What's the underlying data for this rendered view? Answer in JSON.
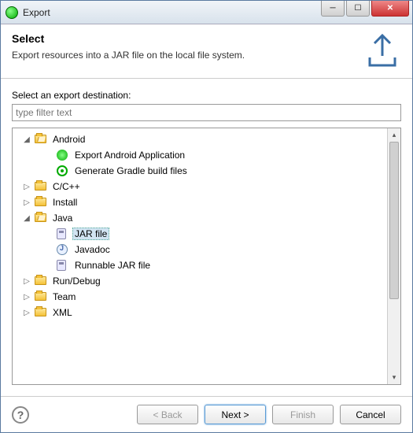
{
  "window": {
    "title": "Export"
  },
  "header": {
    "heading": "Select",
    "subtext": "Export resources into a JAR file on the local file system."
  },
  "body": {
    "label": "Select an export destination:",
    "filter_placeholder": "type filter text"
  },
  "tree": {
    "android": {
      "label": "Android",
      "children": {
        "export_app": "Export Android Application",
        "gradle": "Generate Gradle build files"
      }
    },
    "cpp": "C/C++",
    "install": "Install",
    "java": {
      "label": "Java",
      "children": {
        "jar": "JAR file",
        "javadoc": "Javadoc",
        "runnable": "Runnable JAR file"
      }
    },
    "run_debug": "Run/Debug",
    "team": "Team",
    "xml": "XML"
  },
  "footer": {
    "back": "< Back",
    "next": "Next >",
    "finish": "Finish",
    "cancel": "Cancel"
  }
}
